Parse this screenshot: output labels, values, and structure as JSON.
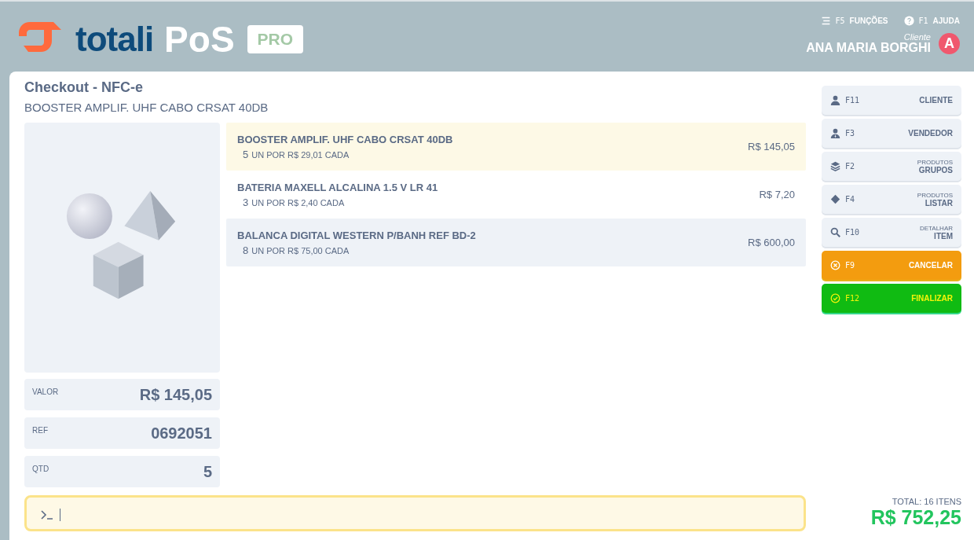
{
  "header": {
    "logo": {
      "brand": "totali",
      "product": "PoS",
      "edition": "PRO"
    },
    "shortcuts": [
      {
        "key": "F5",
        "label": "FUNÇÕES"
      },
      {
        "key": "F1",
        "label": "AJUDA"
      }
    ],
    "client": {
      "caption": "Cliente",
      "name": "ANA MARIA BORGHI",
      "initial": "A"
    }
  },
  "checkout": {
    "title": "Checkout - NFC-e",
    "subtitle": "BOOSTER AMPLIF. UHF CABO CRSAT 40DB",
    "details": [
      {
        "label": "VALOR",
        "value": "R$ 145,05"
      },
      {
        "label": "REF",
        "value": "0692051"
      },
      {
        "label": "QTD",
        "value": "5"
      }
    ],
    "items": [
      {
        "name": "BOOSTER AMPLIF. UHF CABO CRSAT 40DB",
        "qty": "5",
        "unit": "UN POR R$ 29,01 CADA",
        "total": "R$ 145,05",
        "selected": true
      },
      {
        "name": "BATERIA MAXELL ALCALINA 1.5 V LR 41",
        "qty": "3",
        "unit": "UN POR R$ 2,40 CADA",
        "total": "R$ 7,20",
        "selected": false
      },
      {
        "name": "BALANCA DIGITAL WESTERN P/BANH REF BD-2",
        "qty": "8",
        "unit": "UN POR R$ 75,00 CADA",
        "total": "R$ 600,00",
        "selected": false
      }
    ],
    "command_line": {
      "focused": true
    }
  },
  "actions": [
    {
      "kind": "neutral",
      "key": "F11",
      "label": "CLIENTE"
    },
    {
      "kind": "neutral",
      "key": "F3",
      "label": "VENDEDOR"
    },
    {
      "kind": "neutral",
      "key": "F2",
      "caption": "PRODUTOS",
      "label": "GRUPOS"
    },
    {
      "kind": "neutral",
      "key": "F4",
      "caption": "PRODUTOS",
      "label": "LISTAR"
    },
    {
      "kind": "neutral",
      "key": "F10",
      "caption": "DETALHAR",
      "label": "ITEM"
    },
    {
      "kind": "cancel",
      "key": "F9",
      "label": "CANCELAR"
    },
    {
      "kind": "confirm",
      "key": "F12",
      "label": "FINALIZAR"
    }
  ],
  "total": {
    "caption": "TOTAL: 16 ITENS",
    "value": "R$ 752,25"
  }
}
